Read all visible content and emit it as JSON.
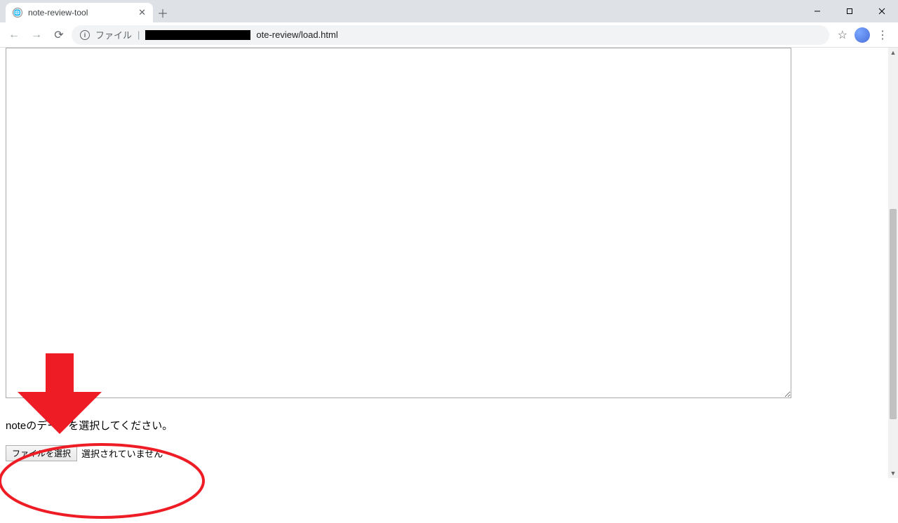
{
  "browser": {
    "tab": {
      "title": "note-review-tool"
    },
    "omnibox": {
      "scheme_label": "ファイル",
      "path_suffix": "ote-review/load.html"
    }
  },
  "page": {
    "textarea_value": "",
    "prompt_text": "noteのデータを選択してください。",
    "file_button_label": "ファイルを選択",
    "file_status_text": "選択されていません"
  }
}
